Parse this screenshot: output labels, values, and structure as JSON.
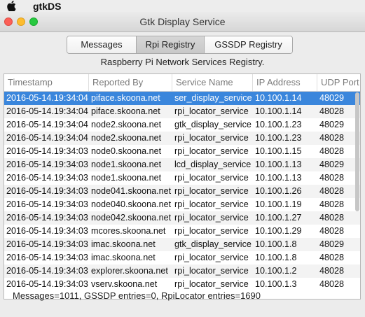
{
  "menubar": {
    "app_name": "gtkDS",
    "apple_icon": "apple-logo-icon"
  },
  "window": {
    "title": "Gtk Display Service"
  },
  "tabs": [
    {
      "label": "Messages",
      "selected": false
    },
    {
      "label": "Rpi Registry",
      "selected": true
    },
    {
      "label": "GSSDP Registry",
      "selected": false
    }
  ],
  "subtitle": "Raspberry Pi Network Services Registry.",
  "table": {
    "headers": [
      "Timestamp",
      "Reported By",
      "Service Name",
      "IP Address",
      "UDP Port"
    ],
    "rows": [
      [
        "2016-05-14.19:34:04",
        "piface.skoona.net",
        "ser_display_service",
        "10.100.1.14",
        "48029"
      ],
      [
        "2016-05-14.19:34:04",
        "piface.skoona.net",
        "rpi_locator_service",
        "10.100.1.14",
        "48028"
      ],
      [
        "2016-05-14.19:34:04",
        "node2.skoona.net",
        "gtk_display_service",
        "10.100.1.23",
        "48029"
      ],
      [
        "2016-05-14.19:34:04",
        "node2.skoona.net",
        "rpi_locator_service",
        "10.100.1.23",
        "48028"
      ],
      [
        "2016-05-14.19:34:03",
        "node0.skoona.net",
        "rpi_locator_service",
        "10.100.1.15",
        "48028"
      ],
      [
        "2016-05-14.19:34:03",
        "node1.skoona.net",
        "lcd_display_service",
        "10.100.1.13",
        "48029"
      ],
      [
        "2016-05-14.19:34:03",
        "node1.skoona.net",
        "rpi_locator_service",
        "10.100.1.13",
        "48028"
      ],
      [
        "2016-05-14.19:34:03",
        "node041.skoona.net",
        "rpi_locator_service",
        "10.100.1.26",
        "48028"
      ],
      [
        "2016-05-14.19:34:03",
        "node040.skoona.net",
        "rpi_locator_service",
        "10.100.1.19",
        "48028"
      ],
      [
        "2016-05-14.19:34:03",
        "node042.skoona.net",
        "rpi_locator_service",
        "10.100.1.27",
        "48028"
      ],
      [
        "2016-05-14.19:34:03",
        "mcores.skoona.net",
        "rpi_locator_service",
        "10.100.1.29",
        "48028"
      ],
      [
        "2016-05-14.19:34:03",
        "imac.skoona.net",
        "gtk_display_service",
        "10.100.1.8",
        "48029"
      ],
      [
        "2016-05-14.19:34:03",
        "imac.skoona.net",
        "rpi_locator_service",
        "10.100.1.8",
        "48028"
      ],
      [
        "2016-05-14.19:34:03",
        "explorer.skoona.net",
        "rpi_locator_service",
        "10.100.1.2",
        "48028"
      ],
      [
        "2016-05-14.19:34:03",
        "vserv.skoona.net",
        "rpi_locator_service",
        "10.100.1.3",
        "48028"
      ]
    ],
    "selected_row": 0
  },
  "status": "Messages=1011, GSSDP entries=0, RpiLocator entries=1690",
  "colors": {
    "selection": "#3a86dc",
    "close": "#fc5f57",
    "minimize": "#fdbc2e",
    "zoom": "#28c940"
  }
}
